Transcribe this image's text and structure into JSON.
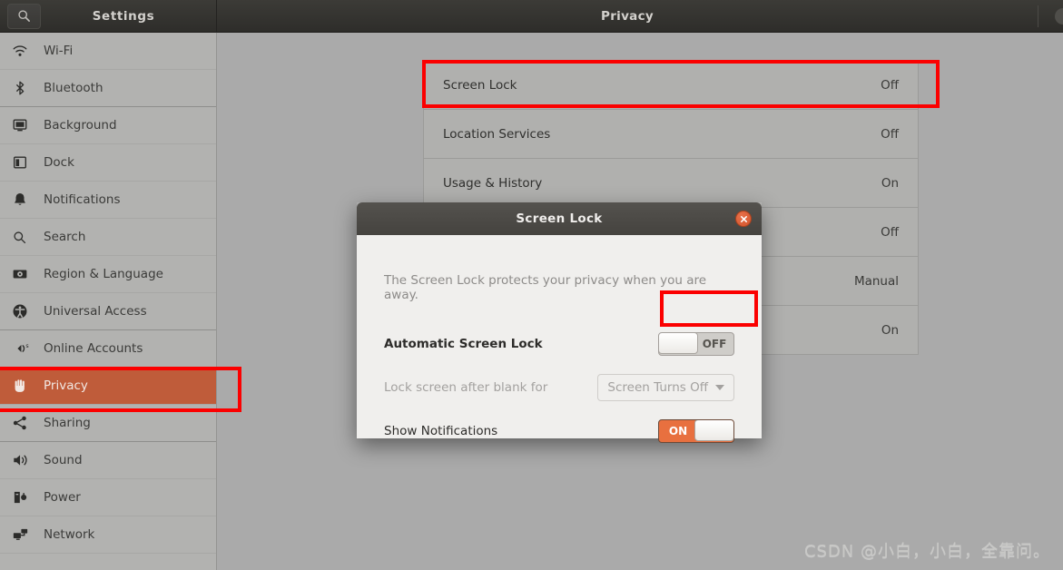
{
  "header": {
    "sidebar_title": "Settings",
    "panel_title": "Privacy",
    "search_icon": "search-icon",
    "close_icon": "close-icon"
  },
  "sidebar": {
    "items": [
      {
        "label": "Wi-Fi",
        "icon": "wifi-icon",
        "selected": false,
        "group_end": false
      },
      {
        "label": "Bluetooth",
        "icon": "bluetooth-icon",
        "selected": false,
        "group_end": true
      },
      {
        "label": "Background",
        "icon": "background-icon",
        "selected": false,
        "group_end": false
      },
      {
        "label": "Dock",
        "icon": "dock-icon",
        "selected": false,
        "group_end": false
      },
      {
        "label": "Notifications",
        "icon": "bell-icon",
        "selected": false,
        "group_end": false
      },
      {
        "label": "Search",
        "icon": "search-icon",
        "selected": false,
        "group_end": false
      },
      {
        "label": "Region & Language",
        "icon": "region-language-icon",
        "selected": false,
        "group_end": false
      },
      {
        "label": "Universal Access",
        "icon": "universal-access-icon",
        "selected": false,
        "group_end": true
      },
      {
        "label": "Online Accounts",
        "icon": "online-accounts-icon",
        "selected": false,
        "group_end": false
      },
      {
        "label": "Privacy",
        "icon": "privacy-hand-icon",
        "selected": true,
        "group_end": false
      },
      {
        "label": "Sharing",
        "icon": "sharing-icon",
        "selected": false,
        "group_end": true
      },
      {
        "label": "Sound",
        "icon": "sound-icon",
        "selected": false,
        "group_end": false
      },
      {
        "label": "Power",
        "icon": "power-icon",
        "selected": false,
        "group_end": false
      },
      {
        "label": "Network",
        "icon": "network-icon",
        "selected": false,
        "group_end": false
      }
    ]
  },
  "privacy_rows": [
    {
      "label": "Screen Lock",
      "value": "Off"
    },
    {
      "label": "Location Services",
      "value": "Off"
    },
    {
      "label": "Usage & History",
      "value": "On"
    },
    {
      "label": "",
      "value": "Off"
    },
    {
      "label": "",
      "value": "Manual"
    },
    {
      "label": "",
      "value": "On"
    }
  ],
  "dialog": {
    "title": "Screen Lock",
    "close_icon": "close-icon",
    "description": "The Screen Lock protects your privacy when you are away.",
    "automatic_screen_lock": {
      "label": "Automatic Screen Lock",
      "state": "OFF"
    },
    "lock_after_blank": {
      "label": "Lock screen after blank for",
      "value": "Screen Turns Off",
      "caret_icon": "chevron-down-icon"
    },
    "show_notifications": {
      "label": "Show Notifications",
      "state": "ON"
    }
  },
  "annotations": {
    "color": "#fb0000",
    "boxes": [
      "screen-lock-row",
      "privacy-sidebar-item",
      "automatic-screen-lock-toggle"
    ]
  },
  "watermark": "CSDN @小白，小白，全靠问。"
}
